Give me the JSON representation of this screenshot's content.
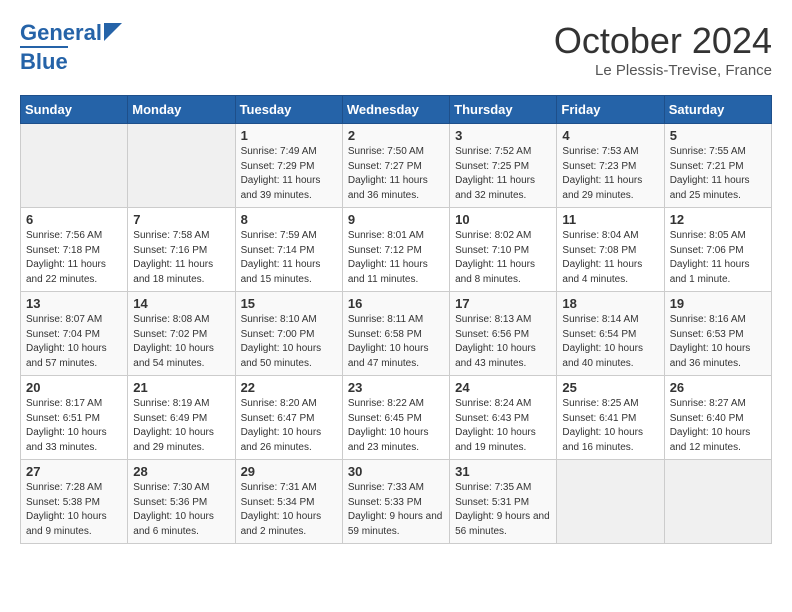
{
  "header": {
    "logo_line1": "General",
    "logo_line2": "Blue",
    "month": "October 2024",
    "location": "Le Plessis-Trevise, France"
  },
  "days_of_week": [
    "Sunday",
    "Monday",
    "Tuesday",
    "Wednesday",
    "Thursday",
    "Friday",
    "Saturday"
  ],
  "weeks": [
    [
      {
        "day": "",
        "empty": true
      },
      {
        "day": "",
        "empty": true
      },
      {
        "day": "1",
        "sunrise": "Sunrise: 7:49 AM",
        "sunset": "Sunset: 7:29 PM",
        "daylight": "Daylight: 11 hours and 39 minutes."
      },
      {
        "day": "2",
        "sunrise": "Sunrise: 7:50 AM",
        "sunset": "Sunset: 7:27 PM",
        "daylight": "Daylight: 11 hours and 36 minutes."
      },
      {
        "day": "3",
        "sunrise": "Sunrise: 7:52 AM",
        "sunset": "Sunset: 7:25 PM",
        "daylight": "Daylight: 11 hours and 32 minutes."
      },
      {
        "day": "4",
        "sunrise": "Sunrise: 7:53 AM",
        "sunset": "Sunset: 7:23 PM",
        "daylight": "Daylight: 11 hours and 29 minutes."
      },
      {
        "day": "5",
        "sunrise": "Sunrise: 7:55 AM",
        "sunset": "Sunset: 7:21 PM",
        "daylight": "Daylight: 11 hours and 25 minutes."
      }
    ],
    [
      {
        "day": "6",
        "sunrise": "Sunrise: 7:56 AM",
        "sunset": "Sunset: 7:18 PM",
        "daylight": "Daylight: 11 hours and 22 minutes."
      },
      {
        "day": "7",
        "sunrise": "Sunrise: 7:58 AM",
        "sunset": "Sunset: 7:16 PM",
        "daylight": "Daylight: 11 hours and 18 minutes."
      },
      {
        "day": "8",
        "sunrise": "Sunrise: 7:59 AM",
        "sunset": "Sunset: 7:14 PM",
        "daylight": "Daylight: 11 hours and 15 minutes."
      },
      {
        "day": "9",
        "sunrise": "Sunrise: 8:01 AM",
        "sunset": "Sunset: 7:12 PM",
        "daylight": "Daylight: 11 hours and 11 minutes."
      },
      {
        "day": "10",
        "sunrise": "Sunrise: 8:02 AM",
        "sunset": "Sunset: 7:10 PM",
        "daylight": "Daylight: 11 hours and 8 minutes."
      },
      {
        "day": "11",
        "sunrise": "Sunrise: 8:04 AM",
        "sunset": "Sunset: 7:08 PM",
        "daylight": "Daylight: 11 hours and 4 minutes."
      },
      {
        "day": "12",
        "sunrise": "Sunrise: 8:05 AM",
        "sunset": "Sunset: 7:06 PM",
        "daylight": "Daylight: 11 hours and 1 minute."
      }
    ],
    [
      {
        "day": "13",
        "sunrise": "Sunrise: 8:07 AM",
        "sunset": "Sunset: 7:04 PM",
        "daylight": "Daylight: 10 hours and 57 minutes."
      },
      {
        "day": "14",
        "sunrise": "Sunrise: 8:08 AM",
        "sunset": "Sunset: 7:02 PM",
        "daylight": "Daylight: 10 hours and 54 minutes."
      },
      {
        "day": "15",
        "sunrise": "Sunrise: 8:10 AM",
        "sunset": "Sunset: 7:00 PM",
        "daylight": "Daylight: 10 hours and 50 minutes."
      },
      {
        "day": "16",
        "sunrise": "Sunrise: 8:11 AM",
        "sunset": "Sunset: 6:58 PM",
        "daylight": "Daylight: 10 hours and 47 minutes."
      },
      {
        "day": "17",
        "sunrise": "Sunrise: 8:13 AM",
        "sunset": "Sunset: 6:56 PM",
        "daylight": "Daylight: 10 hours and 43 minutes."
      },
      {
        "day": "18",
        "sunrise": "Sunrise: 8:14 AM",
        "sunset": "Sunset: 6:54 PM",
        "daylight": "Daylight: 10 hours and 40 minutes."
      },
      {
        "day": "19",
        "sunrise": "Sunrise: 8:16 AM",
        "sunset": "Sunset: 6:53 PM",
        "daylight": "Daylight: 10 hours and 36 minutes."
      }
    ],
    [
      {
        "day": "20",
        "sunrise": "Sunrise: 8:17 AM",
        "sunset": "Sunset: 6:51 PM",
        "daylight": "Daylight: 10 hours and 33 minutes."
      },
      {
        "day": "21",
        "sunrise": "Sunrise: 8:19 AM",
        "sunset": "Sunset: 6:49 PM",
        "daylight": "Daylight: 10 hours and 29 minutes."
      },
      {
        "day": "22",
        "sunrise": "Sunrise: 8:20 AM",
        "sunset": "Sunset: 6:47 PM",
        "daylight": "Daylight: 10 hours and 26 minutes."
      },
      {
        "day": "23",
        "sunrise": "Sunrise: 8:22 AM",
        "sunset": "Sunset: 6:45 PM",
        "daylight": "Daylight: 10 hours and 23 minutes."
      },
      {
        "day": "24",
        "sunrise": "Sunrise: 8:24 AM",
        "sunset": "Sunset: 6:43 PM",
        "daylight": "Daylight: 10 hours and 19 minutes."
      },
      {
        "day": "25",
        "sunrise": "Sunrise: 8:25 AM",
        "sunset": "Sunset: 6:41 PM",
        "daylight": "Daylight: 10 hours and 16 minutes."
      },
      {
        "day": "26",
        "sunrise": "Sunrise: 8:27 AM",
        "sunset": "Sunset: 6:40 PM",
        "daylight": "Daylight: 10 hours and 12 minutes."
      }
    ],
    [
      {
        "day": "27",
        "sunrise": "Sunrise: 7:28 AM",
        "sunset": "Sunset: 5:38 PM",
        "daylight": "Daylight: 10 hours and 9 minutes."
      },
      {
        "day": "28",
        "sunrise": "Sunrise: 7:30 AM",
        "sunset": "Sunset: 5:36 PM",
        "daylight": "Daylight: 10 hours and 6 minutes."
      },
      {
        "day": "29",
        "sunrise": "Sunrise: 7:31 AM",
        "sunset": "Sunset: 5:34 PM",
        "daylight": "Daylight: 10 hours and 2 minutes."
      },
      {
        "day": "30",
        "sunrise": "Sunrise: 7:33 AM",
        "sunset": "Sunset: 5:33 PM",
        "daylight": "Daylight: 9 hours and 59 minutes."
      },
      {
        "day": "31",
        "sunrise": "Sunrise: 7:35 AM",
        "sunset": "Sunset: 5:31 PM",
        "daylight": "Daylight: 9 hours and 56 minutes."
      },
      {
        "day": "",
        "empty": true
      },
      {
        "day": "",
        "empty": true
      }
    ]
  ]
}
